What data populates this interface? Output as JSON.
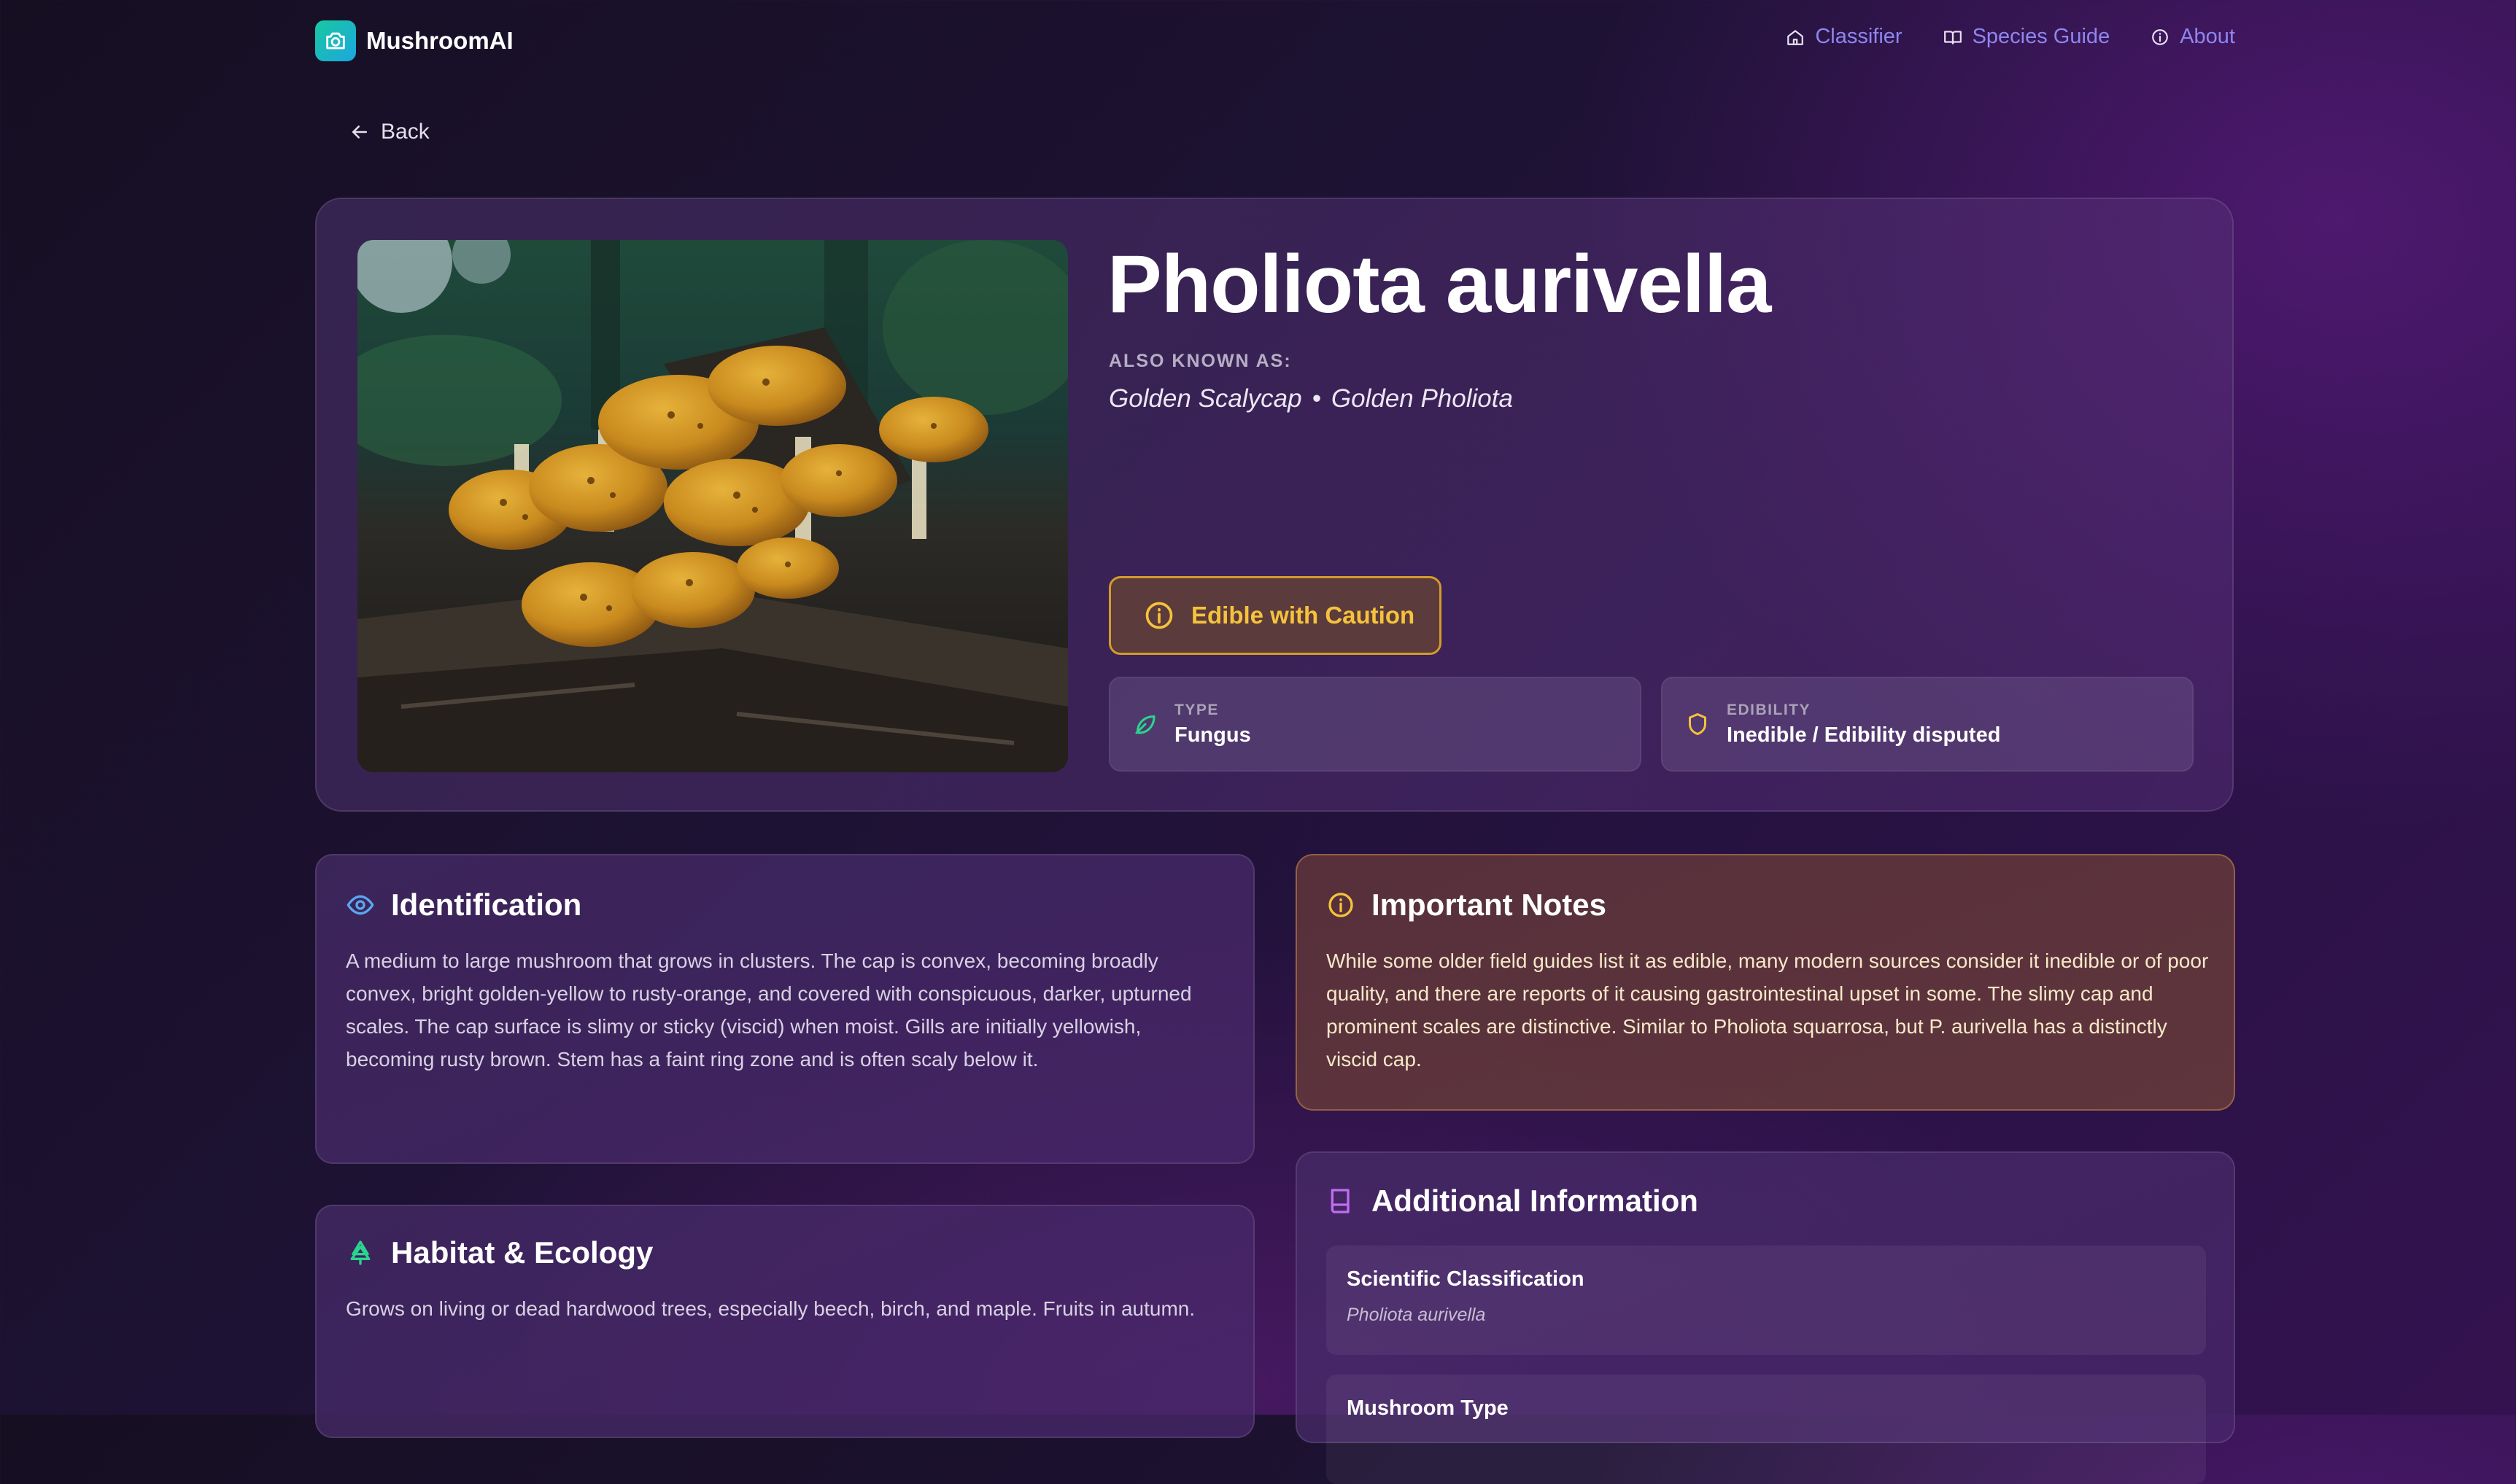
{
  "nav": {
    "brand": "MushroomAI",
    "links": [
      {
        "label": "Classifier",
        "icon": "home-icon"
      },
      {
        "label": "Species Guide",
        "icon": "book-open-icon"
      },
      {
        "label": "About",
        "icon": "info-icon"
      }
    ]
  },
  "back": {
    "label": "Back"
  },
  "species": {
    "name": "Pholiota aurivella",
    "aka_label": "ALSO KNOWN AS:",
    "aka_names": [
      "Golden Scalycap",
      "•",
      "Golden Pholiota"
    ],
    "badge": "Edible with Caution",
    "type_label": "TYPE",
    "type_value": "Fungus",
    "edibility_label": "EDIBILITY",
    "edibility_value": "Inedible / Edibility disputed"
  },
  "identification": {
    "title": "Identification",
    "text": "A medium to large mushroom that grows in clusters. The cap is convex, becoming broadly convex, bright golden-yellow to rusty-orange, and covered with conspicuous, darker, upturned scales. The cap surface is slimy or sticky (viscid) when moist. Gills are initially yellowish, becoming rusty brown. Stem has a faint ring zone and is often scaly below it."
  },
  "notes": {
    "title": "Important Notes",
    "text": "While some older field guides list it as edible, many modern sources consider it inedible or of poor quality, and there are reports of it causing gastrointestinal upset in some. The slimy cap and prominent scales are distinctive. Similar to Pholiota squarrosa, but P. aurivella has a distinctly viscid cap."
  },
  "habitat": {
    "title": "Habitat & Ecology",
    "text": "Grows on living or dead hardwood trees, especially beech, birch, and maple. Fruits in autumn."
  },
  "additional": {
    "title": "Additional Information",
    "items": [
      {
        "title": "Scientific Classification",
        "value": "Pholiota aurivella"
      },
      {
        "title": "Mushroom Type",
        "value": ""
      }
    ]
  },
  "colors": {
    "accent": "#8e86f0",
    "caution": "#f5c33b",
    "brand_gradient_start": "#19c8a0",
    "brand_gradient_end": "#1aa7e0"
  }
}
